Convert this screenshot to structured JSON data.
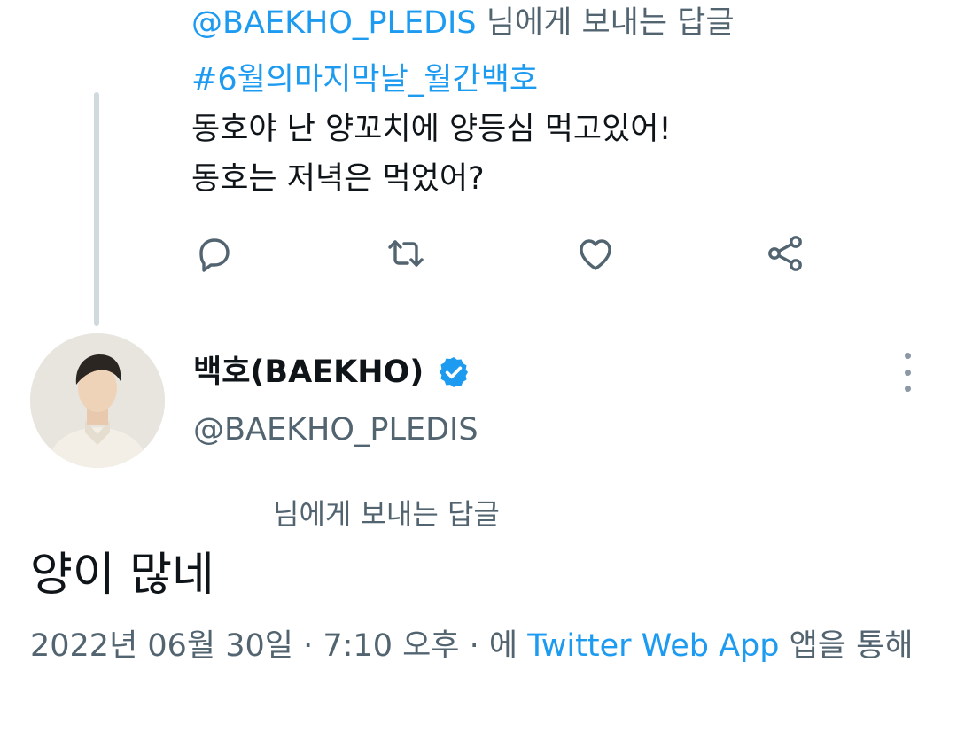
{
  "previous_tweet": {
    "reply_to_handle": "@BAEKHO_PLEDIS",
    "reply_to_suffix": " 님에게 보내는 답글",
    "hashtag": "#6월의마지막날_월간백호",
    "text_line1": "동호야 난 양꼬치에 양등심 먹고있어!",
    "text_line2": "동호는 저녁은 먹었어?",
    "actions": [
      {
        "icon": "reply-icon"
      },
      {
        "icon": "retweet-icon"
      },
      {
        "icon": "like-icon"
      },
      {
        "icon": "share-icon"
      }
    ]
  },
  "author": {
    "display_name": "백호(BAEKHO)",
    "verified": true,
    "handle": "@BAEKHO_PLEDIS",
    "avatar_icon": "avatar-photo"
  },
  "tweet": {
    "reply_note": "님에게 보내는 답글",
    "text": "양이 많네",
    "timestamp": "2022년 06월 30일 · 7:10 오후 · 에",
    "app_name": "Twitter Web App",
    "source_suffix": "앱을 통해"
  },
  "colors": {
    "link": "#1d9bf0",
    "secondary_text": "#536471",
    "thread_line": "#cfd9de"
  }
}
